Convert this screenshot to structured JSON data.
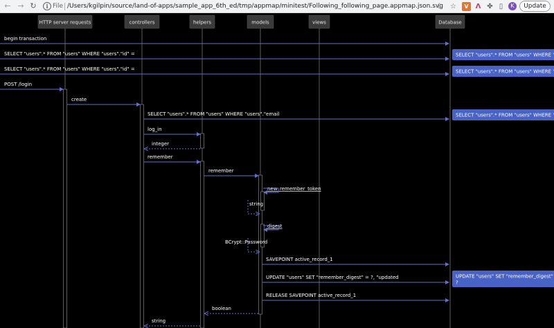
{
  "browser": {
    "scheme_label": "File",
    "url": "/Users/kgilpin/source/land-of-apps/sample_app_6th_ed/tmp/appmap/minitest/Following_following_page.appmap.json.svg",
    "profile_initial": "K",
    "update_label": "Update"
  },
  "lifelines": [
    {
      "id": "http",
      "label": "HTTP server requests"
    },
    {
      "id": "controllers",
      "label": "controllers"
    },
    {
      "id": "helpers",
      "label": "helpers"
    },
    {
      "id": "models",
      "label": "models"
    },
    {
      "id": "views",
      "label": "views"
    },
    {
      "id": "database",
      "label": "Database"
    }
  ],
  "messages": [
    {
      "label": "begin transaction",
      "from": "left",
      "to": "database",
      "kind": "call"
    },
    {
      "label": "SELECT \"users\".* FROM \"users\" WHERE \"users\".\"id\" =",
      "from": "left",
      "to": "database",
      "kind": "call"
    },
    {
      "label": "SELECT \"users\".* FROM \"users\" WHERE \"users\".\"id\" =",
      "from": "left",
      "to": "database",
      "kind": "call"
    },
    {
      "label": "POST /login",
      "from": "left",
      "to": "http",
      "kind": "call"
    },
    {
      "label": "create",
      "from": "http",
      "to": "controllers",
      "kind": "call"
    },
    {
      "label": "SELECT \"users\".* FROM \"users\" WHERE \"users\".\"email",
      "from": "controllers",
      "to": "database",
      "kind": "call"
    },
    {
      "label": "log_in",
      "from": "controllers",
      "to": "helpers",
      "kind": "call"
    },
    {
      "label": "integer",
      "from": "helpers",
      "to": "controllers",
      "kind": "return"
    },
    {
      "label": "remember",
      "from": "controllers",
      "to": "helpers",
      "kind": "call"
    },
    {
      "label": "remember",
      "from": "helpers",
      "to": "models",
      "kind": "call"
    },
    {
      "label": "new_remember_token",
      "from": "models",
      "to": "models",
      "kind": "self"
    },
    {
      "label": "string",
      "from": "models",
      "to": "models",
      "kind": "self-return"
    },
    {
      "label": "digest",
      "from": "models",
      "to": "models",
      "kind": "self"
    },
    {
      "label": "BCrypt::Password",
      "from": "models",
      "to": "models",
      "kind": "self-return"
    },
    {
      "label": "SAVEPOINT active_record_1",
      "from": "models",
      "to": "database",
      "kind": "call"
    },
    {
      "label": "UPDATE \"users\" SET \"remember_digest\" = ?, \"updated",
      "from": "models",
      "to": "database",
      "kind": "call"
    },
    {
      "label": "RELEASE SAVEPOINT active_record_1",
      "from": "models",
      "to": "database",
      "kind": "call"
    },
    {
      "label": "boolean",
      "from": "models",
      "to": "helpers",
      "kind": "return"
    },
    {
      "label": "string",
      "from": "helpers",
      "to": "controllers",
      "kind": "return"
    }
  ],
  "queries": [
    {
      "lines": [
        "SELECT \"users\".* FROM \"users\" WHERE \"users\".\"i"
      ]
    },
    {
      "lines": [
        "SELECT \"users\".* FROM \"users\" WHERE \"users\".\"i"
      ]
    },
    {
      "lines": [
        "SELECT \"users\".* FROM \"users\" WHERE \"users\".\"e"
      ]
    },
    {
      "lines": [
        "UPDATE \"users\" SET \"remember_digest\" = ?, \"u",
        "?"
      ]
    }
  ],
  "colors": {
    "arrow": "#5b6fd6",
    "query_box": "#4962c6",
    "header_box": "#3a3a3a",
    "lifeline": "#9a9a9a",
    "background": "#000000"
  }
}
